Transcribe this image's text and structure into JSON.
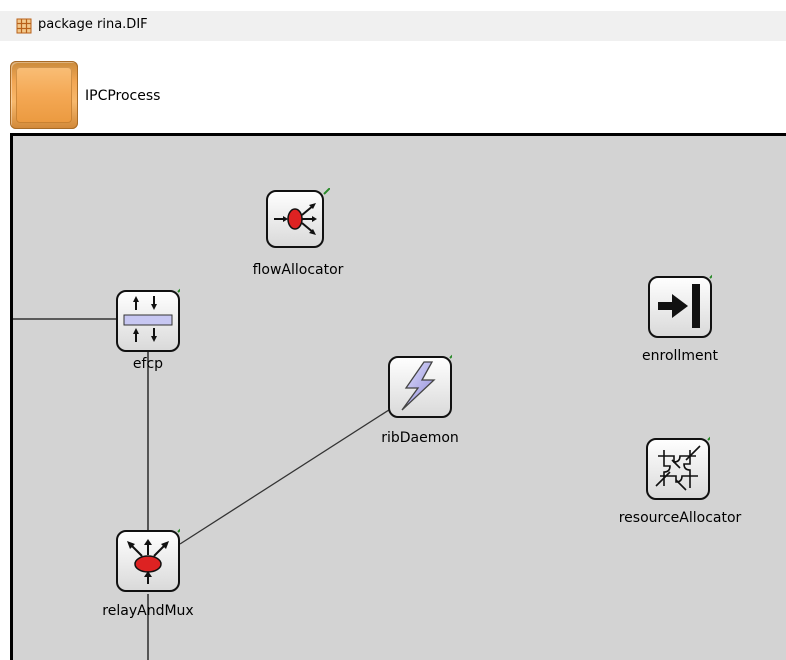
{
  "package": {
    "label": "package rina.DIF",
    "icon": "package-icon"
  },
  "module": {
    "name": "IPCProcess",
    "icon": "compound-module-icon",
    "icon_color": "#f2a654"
  },
  "canvas": {
    "background": "#d3d3d3",
    "submodules": [
      {
        "name": "flowAllocator",
        "icon": "flow-allocator-icon"
      },
      {
        "name": "efcp",
        "icon": "efcp-icon"
      },
      {
        "name": "enrollment",
        "icon": "enrollment-icon"
      },
      {
        "name": "ribDaemon",
        "icon": "rib-daemon-icon"
      },
      {
        "name": "resourceAllocator",
        "icon": "resource-allocator-icon"
      },
      {
        "name": "relayAndMux",
        "icon": "relay-and-mux-icon"
      }
    ]
  }
}
